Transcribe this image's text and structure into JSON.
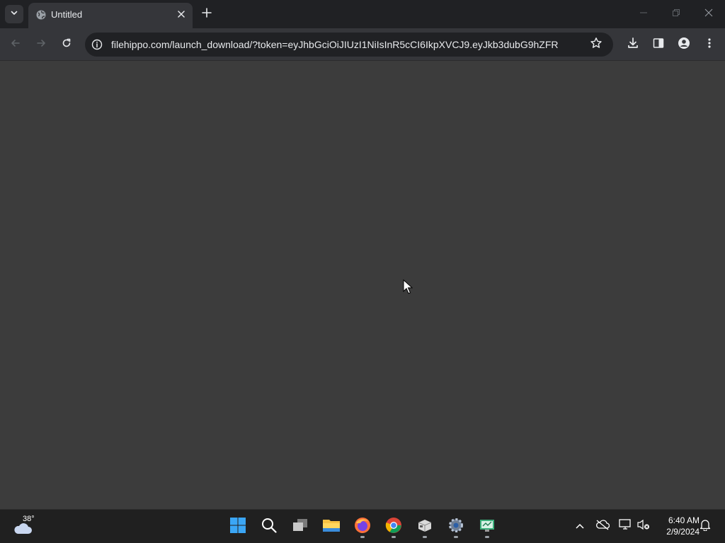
{
  "browser": {
    "tab": {
      "title": "Untitled"
    },
    "address": {
      "domain": "filehippo.com",
      "path": "/launch_download/?token=eyJhbGciOiJIUzI1NiIsInR5cCI6IkpXVCJ9.eyJkb3dubG9hZFR5cGUiOi..."
    }
  },
  "taskbar": {
    "weather": {
      "temp": "38°"
    },
    "apps": [
      "start-icon",
      "search-icon",
      "task-view-icon",
      "file-explorer-icon",
      "firefox-icon",
      "chrome-icon",
      "package-icon",
      "settings-icon",
      "monitor-app-icon"
    ],
    "clock": {
      "time": "6:40 AM",
      "date": "2/9/2024"
    }
  },
  "colors": {
    "content_bg": "#3c3c3c",
    "toolbar_bg": "#35363a",
    "tabstrip_bg": "#202124",
    "taskbar_bg": "#202020"
  }
}
